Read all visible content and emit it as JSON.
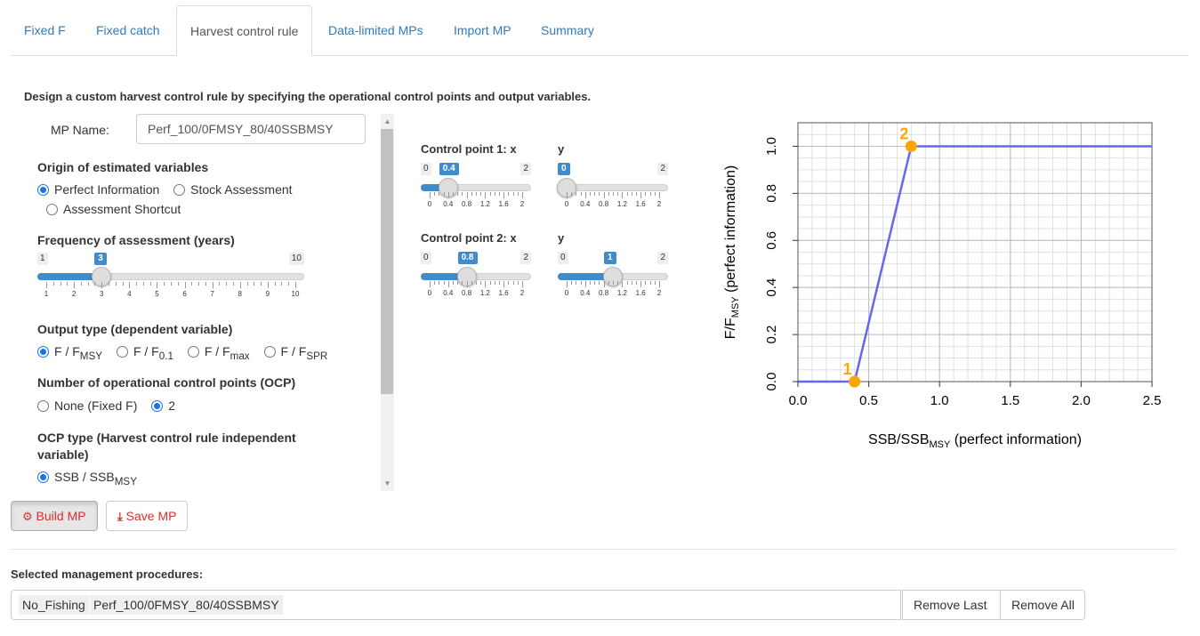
{
  "tabs": [
    {
      "label": "Fixed F"
    },
    {
      "label": "Fixed catch"
    },
    {
      "label": "Harvest control rule"
    },
    {
      "label": "Data-limited MPs"
    },
    {
      "label": "Import MP"
    },
    {
      "label": "Summary"
    }
  ],
  "intro": "Design a custom harvest control rule by specifying the operational control points and output variables.",
  "mp_name": {
    "label": "MP Name:",
    "value": "Perf_100/0FMSY_80/40SSBMSY"
  },
  "origin": {
    "label": "Origin of estimated variables",
    "options": [
      "Perfect Information",
      "Stock Assessment",
      "Assessment Shortcut"
    ],
    "selected": "Perfect Information"
  },
  "frequency": {
    "label": "Frequency of assessment (years)",
    "min": 1,
    "max": 10,
    "value": 3,
    "ticks": [
      "1",
      "2",
      "3",
      "4",
      "5",
      "6",
      "7",
      "8",
      "9",
      "10"
    ]
  },
  "output_type": {
    "label": "Output type (dependent variable)",
    "options": [
      {
        "main": "F / F",
        "sub": "MSY"
      },
      {
        "main": "F / F",
        "sub": "0.1"
      },
      {
        "main": "F / F",
        "sub": "max"
      },
      {
        "main": "F / F",
        "sub": "SPR"
      }
    ],
    "selected_index": 0
  },
  "ocp_count": {
    "label": "Number of operational control points (OCP)",
    "options": [
      "None (Fixed F)",
      "2"
    ],
    "selected": "2"
  },
  "ocp_type": {
    "label": "OCP type (Harvest control rule independent variable)",
    "option": {
      "main": "SSB / SSB",
      "sub": "MSY"
    }
  },
  "sliders": {
    "cp1_x": {
      "label": "Control point 1: x",
      "min": 0,
      "max": 2,
      "value": 0.4
    },
    "cp1_y": {
      "label": "y",
      "min": 0,
      "max": 2,
      "value": 0
    },
    "cp2_x": {
      "label": "Control point 2: x",
      "min": 0,
      "max": 2,
      "value": 0.8
    },
    "cp2_y": {
      "label": "y",
      "min": 0,
      "max": 2,
      "value": 1
    },
    "ticks": [
      "0",
      "0.4",
      "0.8",
      "1.2",
      "1.6",
      "2"
    ]
  },
  "buttons": {
    "build": "Build MP",
    "save": "Save MP",
    "remove_last": "Remove Last",
    "remove_all": "Remove All"
  },
  "selected": {
    "label": "Selected management procedures:",
    "items": [
      "No_Fishing",
      "Perf_100/0FMSY_80/40SSBMSY"
    ]
  },
  "colors": {
    "accent": "#428bca",
    "link": "#337ab7",
    "line": "#6666ee",
    "points": "#ffa500",
    "danger": "#d9302c"
  },
  "chart_data": {
    "type": "line",
    "x": [
      0,
      0.4,
      0.8,
      2.5
    ],
    "y": [
      0,
      0,
      1,
      1
    ],
    "points": [
      {
        "label": "1",
        "x": 0.4,
        "y": 0
      },
      {
        "label": "2",
        "x": 0.8,
        "y": 1
      }
    ],
    "xlim": [
      0,
      2.5
    ],
    "ylim": [
      0,
      1.1
    ],
    "xticks": [
      "0.0",
      "0.5",
      "1.0",
      "1.5",
      "2.0",
      "2.5"
    ],
    "yticks": [
      "0.0",
      "0.2",
      "0.4",
      "0.6",
      "0.8",
      "1.0"
    ],
    "xlabel": {
      "main": "SSB/SSB",
      "sub": "MSY",
      "suffix": "(perfect  information)"
    },
    "ylabel": {
      "main": "F/F",
      "sub": "MSY",
      "suffix": "(perfect  information)"
    },
    "grid": true
  }
}
